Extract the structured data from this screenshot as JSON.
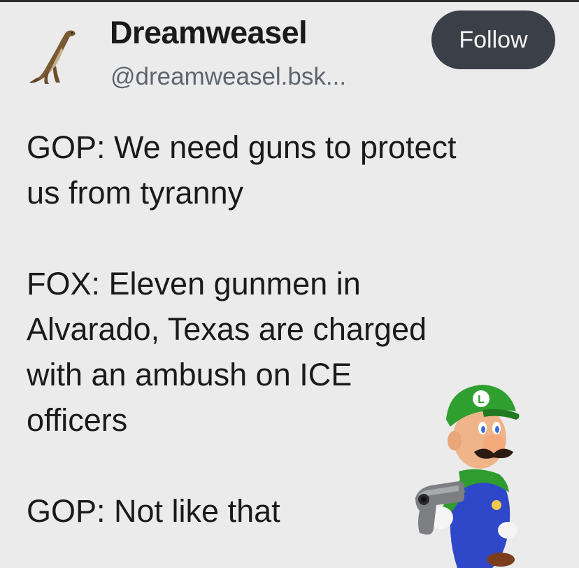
{
  "author": {
    "display_name": "Dreamweasel",
    "handle": "@dreamweasel.bsk...",
    "avatar_icon": "weasel-avatar-icon"
  },
  "follow_button": {
    "label": "Follow"
  },
  "post": {
    "paragraphs": [
      {
        "lines": [
          "GOP: We need guns to protect",
          "us from tyranny"
        ]
      },
      {
        "lines": [
          "FOX: Eleven gunmen in",
          "Alvarado, Texas are charged",
          "with an ambush on ICE",
          "officers"
        ]
      },
      {
        "lines": [
          "GOP: Not like that"
        ]
      }
    ]
  },
  "meme_sticker": {
    "icon": "luigi-with-gun-icon",
    "cap_letter": "L"
  },
  "colors": {
    "background": "#ebebeb",
    "follow_button_bg": "#3b3f47",
    "handle_text": "#5e6470"
  }
}
